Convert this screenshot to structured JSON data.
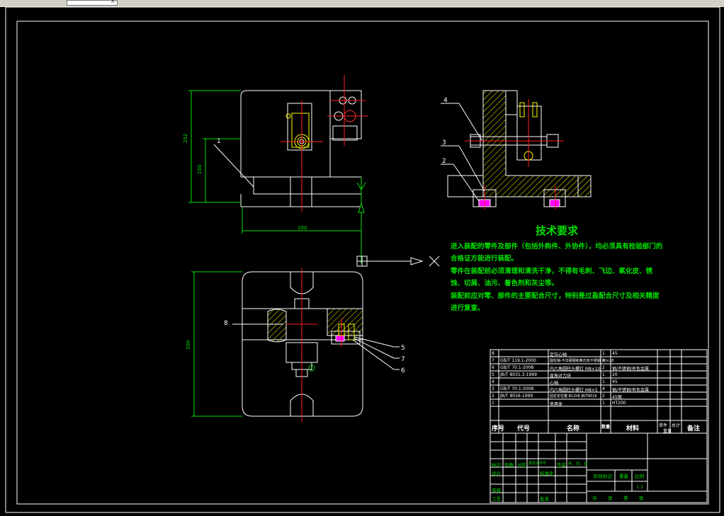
{
  "window": {
    "tab_close_glyph": "×"
  },
  "technical_requirements": {
    "title": "技术要求",
    "lines": [
      "进入装配的零件及部件（包括外购件、外协件），均必须具有检验部门的合格证方能进行装配。",
      "零件在装配前必须清理和清洗干净，不得有毛刺、飞边、氧化皮、锈蚀、切屑、油污、着色剂和灰尘等。",
      "装配前应对零、部件的主要配合尺寸，特别是过盈配合尺寸及相关精度进行复查。"
    ]
  },
  "part_labels": {
    "front": [
      "1"
    ],
    "side": [
      "4",
      "3",
      "2"
    ],
    "top": [
      "8",
      "5",
      "7",
      "6"
    ]
  },
  "dimensions": {
    "height_total": "252",
    "height_partial": "150",
    "width": "200",
    "plan_height": "200"
  },
  "bom": {
    "rows": [
      {
        "no": "8",
        "code": "",
        "name": "定位心轴",
        "qty": "1",
        "material": "45"
      },
      {
        "no": "7",
        "code": "GB/T 119.1-2000",
        "name": "圆柱销-不淬硬钢和奥氏体不锈钢 10×28",
        "qty": "4",
        "material": ""
      },
      {
        "no": "6",
        "code": "GB/T 70.1-2008",
        "name": "内六角圆柱头螺钉 M8×10",
        "qty": "2",
        "material": "钢/不锈钢/有色金属"
      },
      {
        "no": "5",
        "code": "JB/T 8031.3-1999",
        "name": "直角对刀块",
        "qty": "1",
        "material": "20"
      },
      {
        "no": "4",
        "code": "",
        "name": "心轴",
        "qty": "1",
        "material": "45"
      },
      {
        "no": "3",
        "code": "GB/T 70.1-2008",
        "name": "内六角圆柱头螺钉 M8×5",
        "qty": "4",
        "material": "钢/不锈钢/有色金属"
      },
      {
        "no": "2",
        "code": "JB/T 8016-1999",
        "name": "固定定位键 B12h8 JB/T8016",
        "qty": "2",
        "material": "45钢"
      },
      {
        "no": "1",
        "code": "",
        "name": "夹具体",
        "qty": "1",
        "material": "HT200"
      }
    ],
    "headers": {
      "no": "序号",
      "code": "代号",
      "name": "名称",
      "qty": "数量",
      "material": "材料",
      "unit": "单件",
      "total": "总计",
      "weight": "重量",
      "remark": "备注"
    }
  },
  "title_block": {
    "revision_row": [
      "标记",
      "处数",
      "分区",
      "更改文件号",
      "签名",
      "年、月、日"
    ],
    "roles": [
      "设计",
      "审核",
      "工艺"
    ],
    "standardize": "标准化",
    "approve": "批准",
    "stage": "阶段标记",
    "weight": "重量",
    "scale_label": "比例",
    "scale": "1:1",
    "sheets": [
      "共",
      "张",
      "第",
      "张"
    ]
  },
  "colors": {
    "bg": "#000000",
    "outline": "#ffffff",
    "center": "#ff2020",
    "dim": "#00e000",
    "hatch": "#ffff00",
    "accent": "#ff00ff"
  }
}
